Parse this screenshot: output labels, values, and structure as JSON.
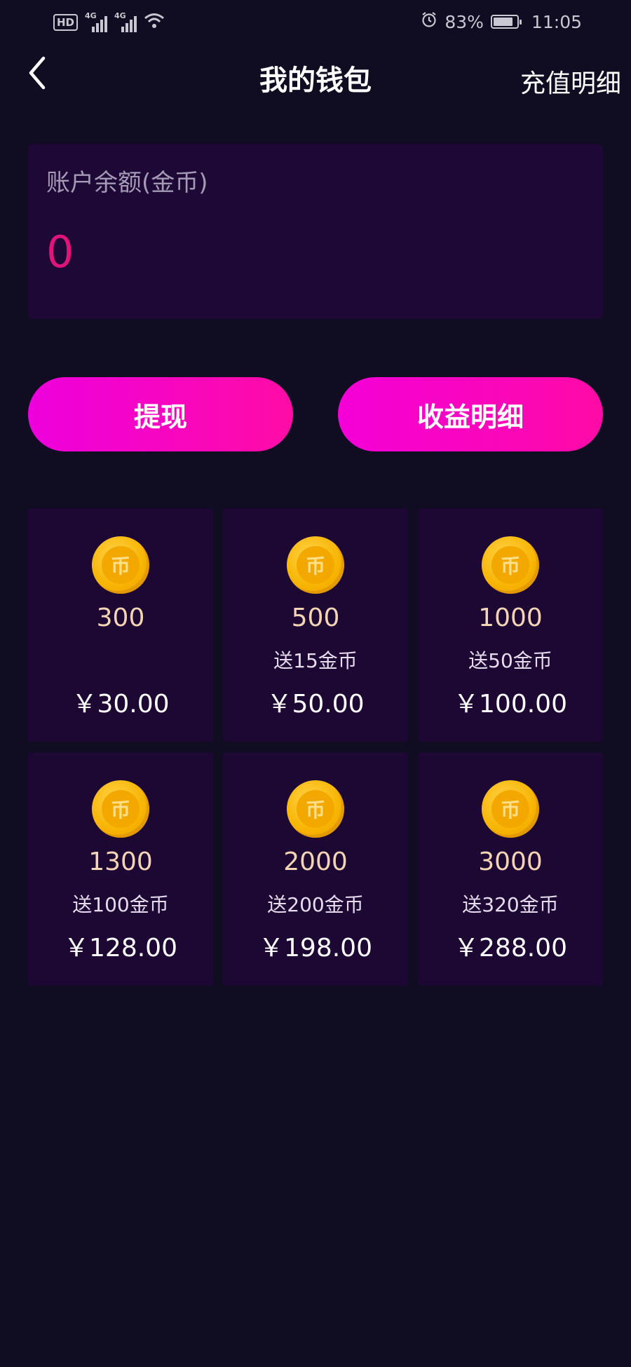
{
  "status_bar": {
    "hd_badge": "HD",
    "network_1": "4G",
    "network_2": "4G",
    "battery_percent": "83%",
    "battery_level": 0.83,
    "time": "11:05",
    "icons": [
      "signal-icon",
      "wifi-icon",
      "alarm-icon",
      "battery-icon"
    ]
  },
  "header": {
    "title": "我的钱包",
    "right_link": "充值明细",
    "back_icon": "chevron-left-icon"
  },
  "balance": {
    "label": "账户余额(金币)",
    "value": "0"
  },
  "actions": {
    "withdraw": "提现",
    "earnings": "收益明细"
  },
  "packages": [
    {
      "coins": "300",
      "bonus": "",
      "price": "￥30.00"
    },
    {
      "coins": "500",
      "bonus": "送15金币",
      "price": "￥50.00"
    },
    {
      "coins": "1000",
      "bonus": "送50金币",
      "price": "￥100.00"
    },
    {
      "coins": "1300",
      "bonus": "送100金币",
      "price": "￥128.00"
    },
    {
      "coins": "2000",
      "bonus": "送200金币",
      "price": "￥198.00"
    },
    {
      "coins": "3000",
      "bonus": "送320金币",
      "price": "￥288.00"
    }
  ],
  "coin_glyph": "币",
  "colors": {
    "background": "#100d22",
    "card": "#1e0835",
    "balance_value": "#e0147a",
    "button_gradient_start": "#ee00dd",
    "button_gradient_end": "#ff0ca6",
    "coin": "#f7b300"
  }
}
